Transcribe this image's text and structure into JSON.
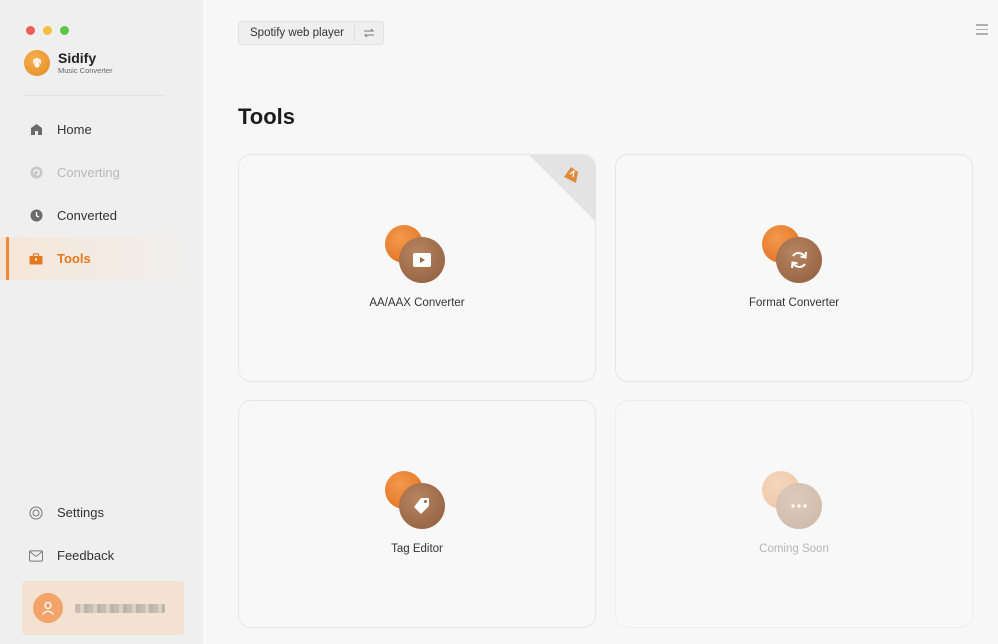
{
  "window": {
    "controls": [
      "close",
      "minimize",
      "zoom"
    ]
  },
  "brand": {
    "name": "Sidify",
    "subtitle": "Music Converter",
    "logo_icon": "sidify-logo-icon",
    "accent": "#e4781f"
  },
  "sidebar": {
    "items": [
      {
        "label": "Home",
        "icon": "home-icon",
        "state": "normal"
      },
      {
        "label": "Converting",
        "icon": "converting-icon",
        "state": "disabled"
      },
      {
        "label": "Converted",
        "icon": "clock-icon",
        "state": "normal"
      },
      {
        "label": "Tools",
        "icon": "toolbox-icon",
        "state": "active"
      }
    ],
    "bottom_items": [
      {
        "label": "Settings",
        "icon": "gear-icon"
      },
      {
        "label": "Feedback",
        "icon": "mail-icon"
      }
    ]
  },
  "user": {
    "avatar_icon": "user-avatar-icon"
  },
  "topbar": {
    "source_label": "Spotify web player",
    "switch_icon": "swap-arrows-icon",
    "menu_icon": "hamburger-menu-icon"
  },
  "main": {
    "title": "Tools",
    "tools": [
      {
        "label": "AA/AAX Converter",
        "icon": "play-video-icon",
        "badge": "new-corner-badge"
      },
      {
        "label": "Format Converter",
        "icon": "refresh-icon"
      },
      {
        "label": "Tag Editor",
        "icon": "tag-icon"
      },
      {
        "label": "Coming Soon",
        "icon": "more-dots-icon",
        "disabled": true
      }
    ]
  }
}
